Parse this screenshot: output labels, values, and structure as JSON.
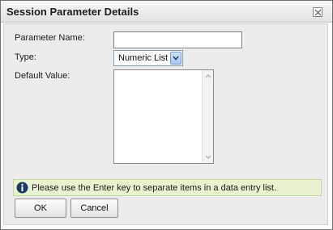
{
  "dialog": {
    "title": "Session Parameter Details",
    "close_icon": "close-icon"
  },
  "form": {
    "parameter_name_label": "Parameter Name:",
    "parameter_name_value": "",
    "type_label": "Type:",
    "type_selected": "Numeric List",
    "default_value_label": "Default Value:",
    "default_value_text": ""
  },
  "info": {
    "icon": "info-icon",
    "message": "Please use the Enter key to separate items in a data entry list."
  },
  "buttons": {
    "ok_label": "OK",
    "cancel_label": "Cancel"
  },
  "colors": {
    "info_bar_bg": "#e9f3cf",
    "info_icon": "#1b3a66",
    "select_arrow": "#a9c6f2"
  }
}
